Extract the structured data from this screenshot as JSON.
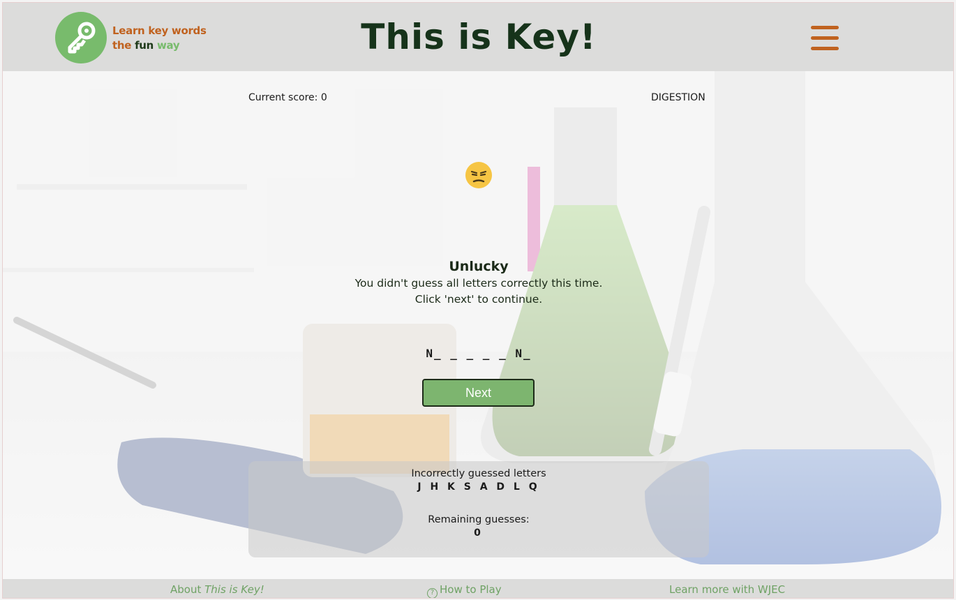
{
  "header": {
    "tagline_line1": "Learn key words",
    "tagline_the": "the",
    "tagline_fun": "fun",
    "tagline_way": "way",
    "title": "This is Key!",
    "logo_icon": "key-icon",
    "menu_icon": "hamburger-menu-icon"
  },
  "game": {
    "score_label": "Current score: 0",
    "category": "DIGESTION",
    "emoji": "unamused-face-emoji",
    "result_title": "Unlucky",
    "result_line1": "You didn't guess all letters correctly this time.",
    "result_line2": "Click 'next' to continue.",
    "word_display": "N_ _ _ _ _ N_",
    "next_label": "Next"
  },
  "guesses": {
    "incorrect_label": "Incorrectly guessed letters",
    "incorrect_letters": "J H K S A D L Q",
    "remaining_label": "Remaining guesses:",
    "remaining_value": "0"
  },
  "footer": {
    "about_prefix": "About",
    "about_em": "This is Key!",
    "howto_label": "How to Play",
    "wjec_label": "Learn more with WJEC"
  },
  "colors": {
    "brand_green": "#78bb6c",
    "brand_orange": "#c0621f",
    "title_dark": "#16331a",
    "button_green": "#7db56f"
  }
}
